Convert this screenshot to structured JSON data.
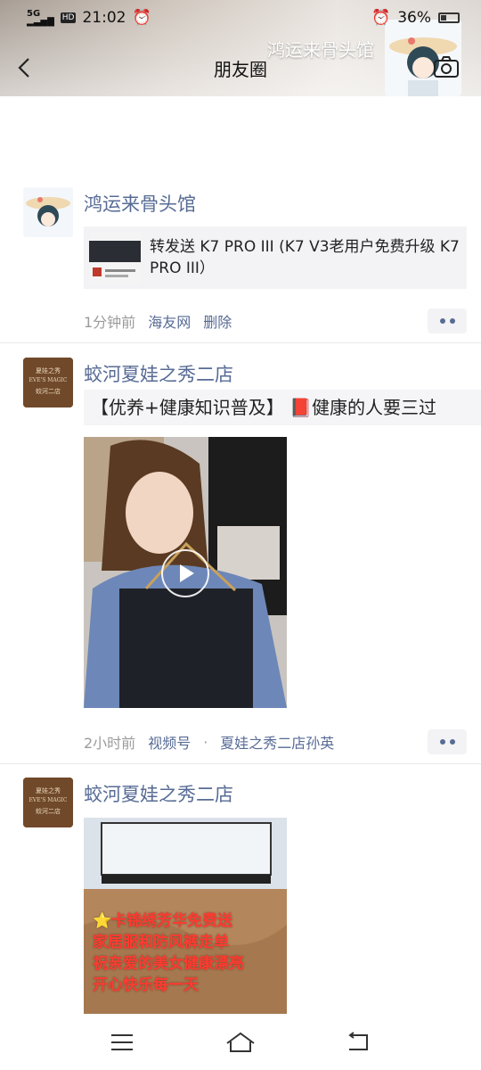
{
  "status_bar": {
    "network": "5G",
    "hd": "HD",
    "time": "21:02",
    "battery": "36%"
  },
  "cover": {
    "name": "鸿运来骨头馆"
  },
  "navbar": {
    "title": "朋友圈"
  },
  "posts": [
    {
      "name": "鸿运来骨头馆",
      "share_title": "转发送 K7 PRO III (K7 V3老用户免费升级 K7 PRO III）",
      "time": "1分钟前",
      "source": "海友网",
      "action": "删除"
    },
    {
      "name": "蛟河夏娃之秀二店",
      "text": "【优养+健康知识普及】 📕健康的人要三过",
      "time": "2小时前",
      "source": "视频号",
      "dot": "·",
      "channel": "夏娃之秀二店孙英"
    },
    {
      "name": "蛟河夏娃之秀二店",
      "overlay_lines": [
        "⭐卡锦绣芳华免费送",
        "家居服和防风裤走单",
        "祝亲爱的美女健康漂亮",
        "开心快乐每一天"
      ]
    }
  ],
  "avatar_text": {
    "line1": "夏娃之秀",
    "line2": "EVE'S MAGIC",
    "line3": "蛟河二店"
  },
  "icons": [
    "back-icon",
    "camera-icon",
    "more-icon",
    "play-icon",
    "menu-icon",
    "home-icon",
    "return-icon",
    "alarm-icon",
    "battery-icon"
  ]
}
